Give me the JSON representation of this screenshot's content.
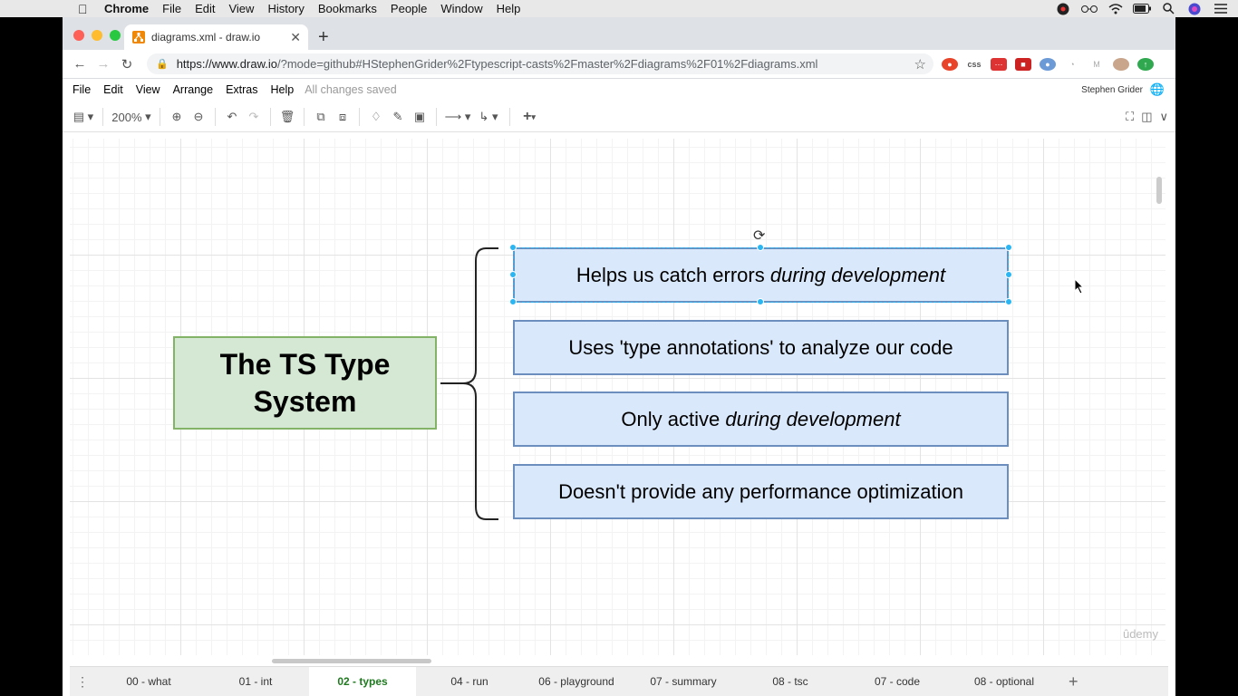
{
  "mac_menubar": {
    "app": "Chrome",
    "items": [
      "File",
      "Edit",
      "View",
      "History",
      "Bookmarks",
      "People",
      "Window",
      "Help"
    ]
  },
  "browser": {
    "tab_title": "diagrams.xml - draw.io",
    "url_host": "https://www.draw.io",
    "url_rest": "/?mode=github#HStephenGrider%2Ftypescript-casts%2Fmaster%2Fdiagrams%2F01%2Fdiagrams.xml"
  },
  "drawio": {
    "menu": [
      "File",
      "Edit",
      "View",
      "Arrange",
      "Extras",
      "Help"
    ],
    "save_status": "All changes saved",
    "user": "Stephen Grider",
    "zoom": "200%"
  },
  "diagram": {
    "main_title": "The TS Type System",
    "items": [
      {
        "plain": "Helps us catch errors ",
        "italic": "during development",
        "tail": ""
      },
      {
        "plain": "Uses 'type annotations' to analyze our code",
        "italic": "",
        "tail": ""
      },
      {
        "plain": "Only active ",
        "italic": "during development",
        "tail": ""
      },
      {
        "plain": "Doesn't provide any performance optimization",
        "italic": "",
        "tail": ""
      }
    ],
    "watermark": "ûdemy"
  },
  "pages": {
    "tabs": [
      "00 - what",
      "01 - int",
      "02 - types",
      "04 - run",
      "06 - playground",
      "07 - summary",
      "08 - tsc",
      "07 - code",
      "08 - optional"
    ],
    "active_index": 2
  },
  "colors": {
    "main_fill": "#d5e8d4",
    "main_stroke": "#82b366",
    "item_fill": "#dae8fc",
    "item_stroke": "#6c8ebf",
    "selection": "#29b6f2"
  }
}
